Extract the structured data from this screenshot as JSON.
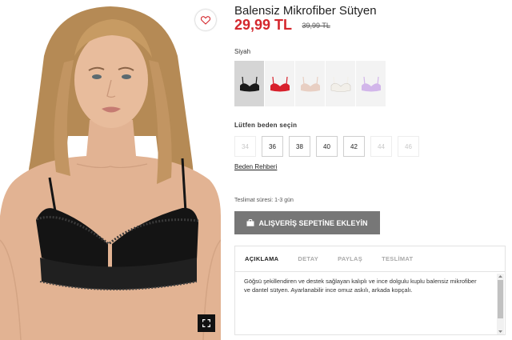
{
  "product": {
    "title": "Balensiz Mikrofiber Sütyen",
    "price": "29,99 TL",
    "old_price": "39,99 TL"
  },
  "colors": {
    "label": "Siyah",
    "swatches": [
      {
        "name": "Siyah",
        "hex": "#1a1a1a",
        "active": true
      },
      {
        "name": "Kırmızı",
        "hex": "#d8202c",
        "active": false
      },
      {
        "name": "Bej",
        "hex": "#e8cfc3",
        "active": false
      },
      {
        "name": "Beyaz",
        "hex": "#f2efe9",
        "active": false
      },
      {
        "name": "Lila",
        "hex": "#d2b6ea",
        "active": false
      }
    ]
  },
  "sizes": {
    "label": "Lütfen beden seçin",
    "options": [
      {
        "label": "34",
        "available": false
      },
      {
        "label": "36",
        "available": true
      },
      {
        "label": "38",
        "available": true
      },
      {
        "label": "40",
        "available": true
      },
      {
        "label": "42",
        "available": true
      },
      {
        "label": "44",
        "available": false
      },
      {
        "label": "46",
        "available": false
      }
    ],
    "guide_label": "Beden Rehberi"
  },
  "delivery": "Teslimat süresi: 1-3 gün",
  "cart_button": {
    "label": "ALIŞVERİŞ SEPETİNE EKLEYİN",
    "icon": "shopping-bag-icon",
    "color": "#777777"
  },
  "tabs": [
    {
      "label": "AÇIKLAMA",
      "active": true
    },
    {
      "label": "DETAY",
      "active": false
    },
    {
      "label": "PAYLAŞ",
      "active": false
    },
    {
      "label": "TESLİMAT",
      "active": false
    }
  ],
  "description": "Göğsü şekillendiren ve destek sağlayan kalıplı ve ince dolgulu kuplu balensiz mikrofiber ve dantel sütyen. Ayarlanabilir ince omuz askılı, arkada kopçalı.",
  "icons": {
    "wishlist": "heart-icon",
    "zoom": "expand-icon"
  },
  "theme": {
    "sale_color": "#d4272d",
    "active_tab": "#222222",
    "inactive_tab": "#aaaaaa"
  }
}
